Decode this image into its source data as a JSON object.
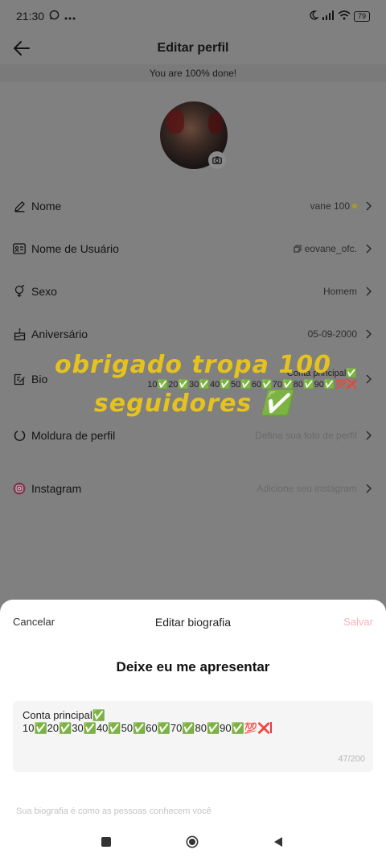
{
  "status_bar": {
    "time": "21:30",
    "battery": "79",
    "network": "4G"
  },
  "header": {
    "title": "Editar perfil"
  },
  "progress_banner": "You are 100% done!",
  "rows": [
    {
      "key": "name",
      "label": "Nome",
      "value": "vane 100"
    },
    {
      "key": "username",
      "label": "Nome de Usuário",
      "value": "eovane_ofc."
    },
    {
      "key": "gender",
      "label": "Sexo",
      "value": "Homem"
    },
    {
      "key": "birthday",
      "label": "Aniversário",
      "value": "05-09-2000"
    },
    {
      "key": "bio",
      "label": "Bio",
      "value_line1": "Conta principal✅",
      "value_line2": "10✅20✅30✅40✅50✅60✅70✅80✅90✅💯❌"
    },
    {
      "key": "frame",
      "label": "Moldura de perfil",
      "value": "Defina sua foto de perfil"
    },
    {
      "key": "instagram",
      "label": "Instagram",
      "value": "Adicione seu instagram"
    }
  ],
  "overlay": {
    "line1": "obrigado tropa 100",
    "line2": "seguidores ✅"
  },
  "sheet": {
    "cancel": "Cancelar",
    "title": "Editar biografia",
    "save": "Salvar",
    "heading": "Deixe eu me apresentar",
    "bio_line1": "Conta principal✅",
    "bio_line2": "10✅20✅30✅40✅50✅60✅70✅80✅90✅💯❌",
    "counter": "47/200",
    "hint": "Sua biografia é como as pessoas conhecem você"
  },
  "colors": {
    "overlay_text": "#e6c21e",
    "save_disabled": "#f3b3bd",
    "caret": "#e8354a"
  }
}
